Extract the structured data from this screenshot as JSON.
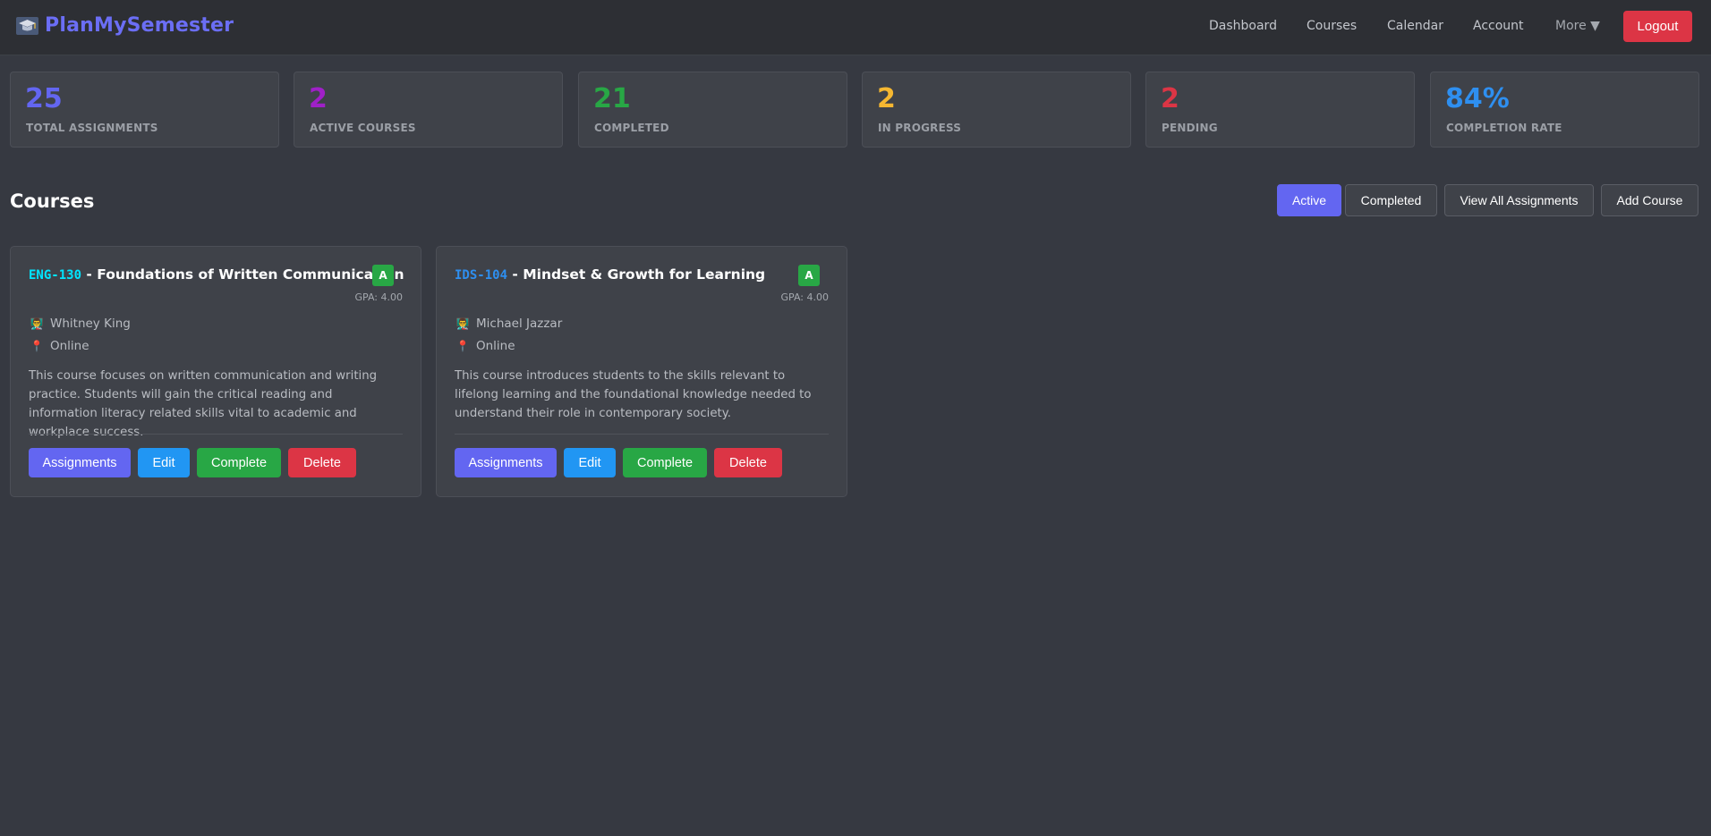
{
  "brand": {
    "name": "PlanMySemester",
    "icon": "graduation-cap-icon"
  },
  "nav": {
    "links": [
      "Dashboard",
      "Courses",
      "Calendar",
      "Account"
    ],
    "more_label": "More ▼",
    "logout_label": "Logout"
  },
  "stats": [
    {
      "value": "25",
      "label": "Total Assignments",
      "color": "#6366f1"
    },
    {
      "value": "2",
      "label": "Active Courses",
      "color": "#a020c8"
    },
    {
      "value": "21",
      "label": "Completed",
      "color": "#28a745"
    },
    {
      "value": "2",
      "label": "In Progress",
      "color": "#f5b731"
    },
    {
      "value": "2",
      "label": "Pending",
      "color": "#dc3545"
    },
    {
      "value": "84%",
      "label": "Completion Rate",
      "color": "#2e8ff0"
    }
  ],
  "section": {
    "title": "Courses",
    "filters": {
      "active": "Active",
      "completed": "Completed"
    },
    "view_all_label": "View All Assignments",
    "add_course_label": "Add Course"
  },
  "courses": [
    {
      "code": "ENG-130",
      "code_color": "#00e5ff",
      "name": " - Foundations of Written Communication",
      "grade": "A",
      "gpa": "GPA: 4.00",
      "instructor": "Whitney King",
      "location": "Online",
      "description": "This course focuses on written communication and writing practice. Students will gain the critical reading and information literacy related skills vital to academic and workplace success.",
      "buttons": {
        "assignments": "Assignments",
        "edit": "Edit",
        "complete": "Complete",
        "delete": "Delete"
      }
    },
    {
      "code": "IDS-104",
      "code_color": "#2e8ff0",
      "name": " - Mindset & Growth for Learning",
      "grade": "A",
      "gpa": "GPA: 4.00",
      "instructor": "Michael Jazzar",
      "location": "Online",
      "description": "This course introduces students to the skills relevant to lifelong learning and the foundational knowledge needed to understand their role in contemporary society.",
      "buttons": {
        "assignments": "Assignments",
        "edit": "Edit",
        "complete": "Complete",
        "delete": "Delete"
      }
    }
  ],
  "icons": {
    "instructor": "teacher-icon",
    "location": "pin-icon"
  }
}
